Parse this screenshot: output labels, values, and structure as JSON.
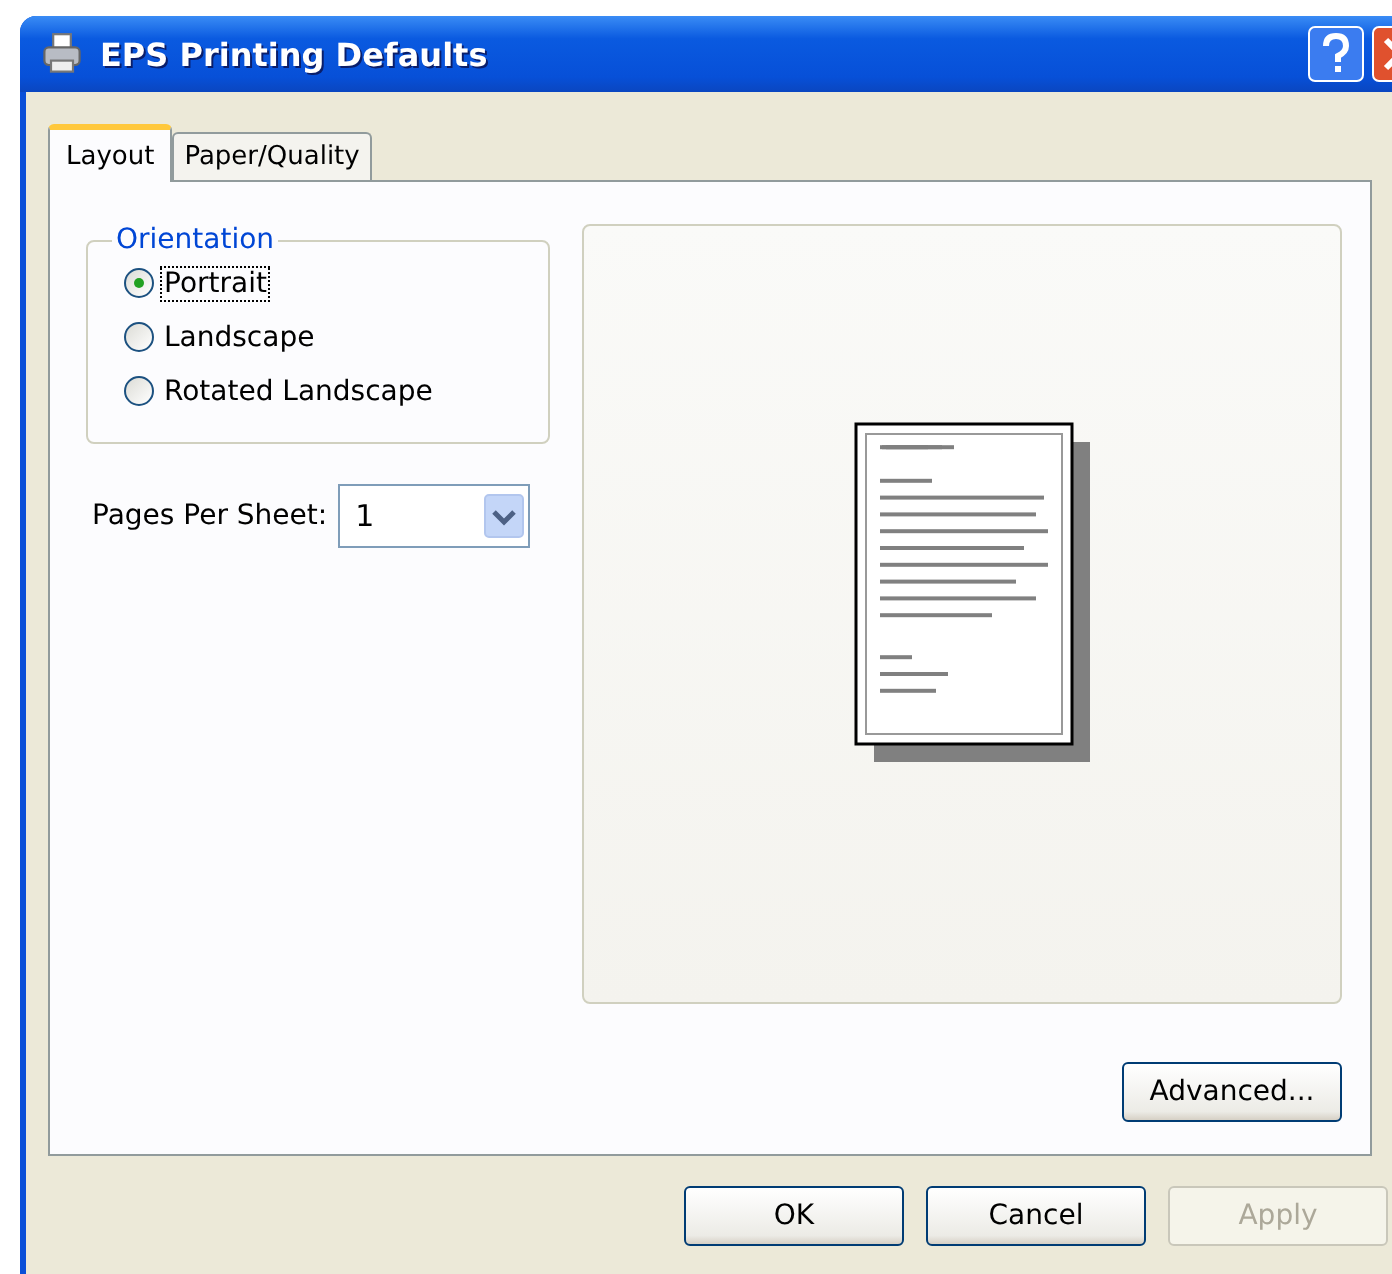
{
  "window": {
    "title": "EPS Printing Defaults"
  },
  "tabs": [
    {
      "label": "Layout",
      "selected": true
    },
    {
      "label": "Paper/Quality",
      "selected": false
    }
  ],
  "orientation": {
    "title": "Orientation",
    "options": [
      {
        "label": "Portrait",
        "selected": true,
        "focused": true
      },
      {
        "label": "Landscape",
        "selected": false,
        "focused": false
      },
      {
        "label": "Rotated Landscape",
        "selected": false,
        "focused": false
      }
    ]
  },
  "pages_per_sheet": {
    "label": "Pages Per Sheet:",
    "value": "1"
  },
  "advanced_button": "Advanced...",
  "buttons": [
    {
      "label": "OK",
      "disabled": false
    },
    {
      "label": "Cancel",
      "disabled": false
    },
    {
      "label": "Apply",
      "disabled": true
    }
  ]
}
